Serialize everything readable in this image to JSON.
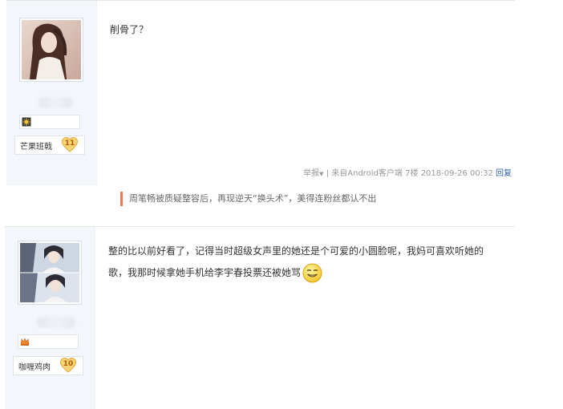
{
  "posts": [
    {
      "badge": {
        "label": "芒果班戟",
        "level": "11"
      },
      "content": "削骨了？",
      "meta": {
        "report": "举报",
        "source": "来自Android客户端",
        "floor": "7楼",
        "time": "2018-09-26 00:32",
        "reply": "回复"
      }
    },
    {
      "badge": {
        "label": "咖喱鸡肉",
        "level": "10"
      },
      "content_line1": "整的比以前好看了，记得当时超级女声里的她还是个可爱的小圆脸呢，我妈可喜欢听她的",
      "content_line2": "歌，我那时候拿她手机给李宇春投票还被她骂"
    }
  ],
  "related_link": "周笔畅被质疑整容后，再现逆天“换头术”，美得连粉丝都认不出",
  "colors": {
    "accent": "#e77b58",
    "link": "#2d64b3",
    "badge_level": "#f2c55c"
  }
}
